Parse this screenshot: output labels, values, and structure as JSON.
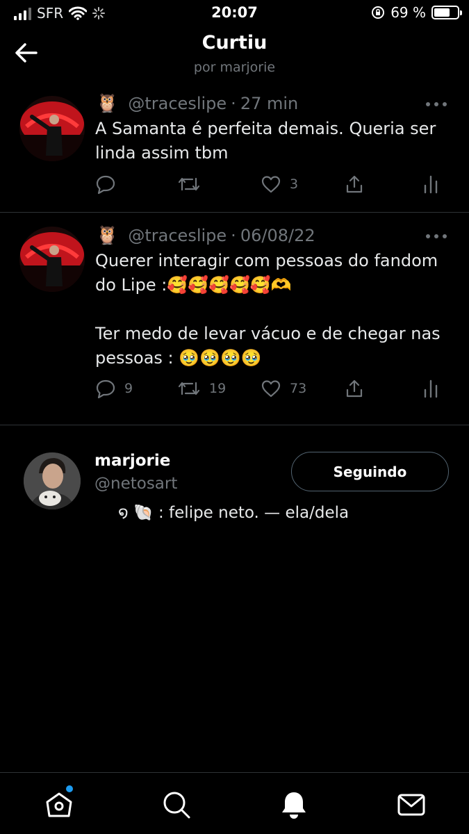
{
  "status_bar": {
    "carrier": "SFR",
    "time": "20:07",
    "battery_percent": "69 %",
    "battery_level": 0.69
  },
  "header": {
    "title": "Curtiu",
    "subtitle": "por marjorie",
    "back_icon": "arrow-left-icon"
  },
  "tweets": [
    {
      "emoji": "🦉",
      "handle": "@traceslipe",
      "separator": "·",
      "time": "27 min",
      "text": "A Samanta é perfeita demais. Queria ser\nlinda assim tbm",
      "replies": "",
      "retweets": "",
      "likes": "3"
    },
    {
      "emoji": "🦉",
      "handle": "@traceslipe",
      "separator": "·",
      "time": "06/08/22",
      "text": "Querer interagir com pessoas do fandom\ndo Lipe :🥰🥰🥰🥰🥰🫶\n\nTer medo de levar vácuo e de chegar nas\npessoas : 🥹🥹🥹🥹",
      "replies": "9",
      "retweets": "19",
      "likes": "73"
    }
  ],
  "user_card": {
    "name": "marjorie",
    "handle": "@netosart",
    "button_label": "Seguindo",
    "bio": "໑ 🐚 : felipe neto. — ela/dela"
  },
  "tab_bar": {
    "items": [
      "home-icon",
      "search-icon",
      "notifications-icon",
      "messages-icon"
    ],
    "home_has_badge": true
  },
  "colors": {
    "background": "#000000",
    "text": "#e7e9ea",
    "muted": "#71767b",
    "accent": "#1d9bf0",
    "divider": "#2f3336"
  }
}
